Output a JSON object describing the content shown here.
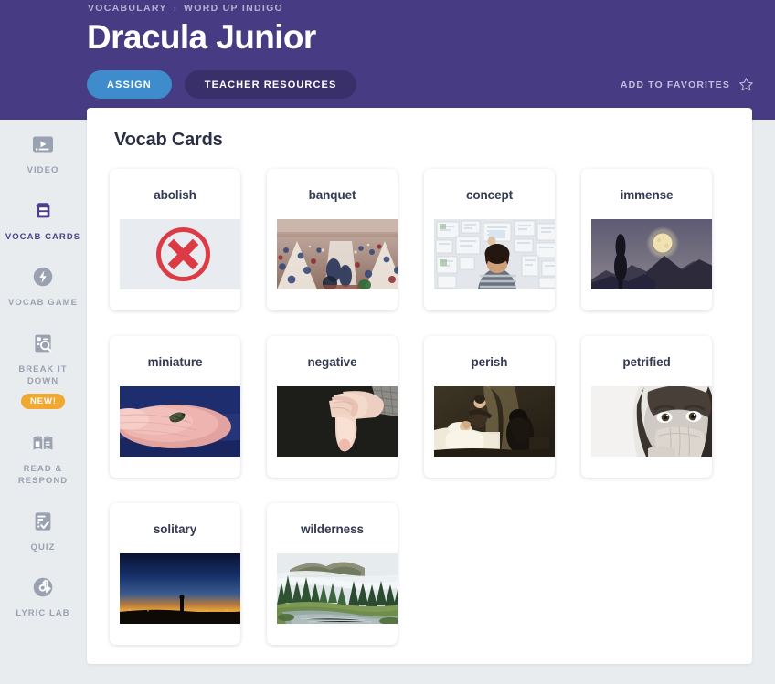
{
  "header": {
    "breadcrumb": [
      {
        "label": "VOCABULARY",
        "name": "breadcrumb-vocabulary"
      },
      {
        "label": "WORD UP INDIGO",
        "name": "breadcrumb-word-up-indigo"
      }
    ],
    "breadcrumb_separator": "›",
    "title": "Dracula Junior",
    "assign_label": "ASSIGN",
    "resources_label": "TEACHER RESOURCES",
    "favorites_label": "ADD TO FAVORITES",
    "favorites_icon": "star-outline-icon",
    "colors": {
      "header_bg": "#473c83",
      "assign_bg": "#3e8ccc",
      "resources_bg": "#3a3069",
      "breadcrumb_text": "#b7b0d4"
    }
  },
  "sidebar": {
    "items": [
      {
        "label": "VIDEO",
        "icon": "video-icon",
        "active": false,
        "badge": null
      },
      {
        "label": "VOCAB CARDS",
        "icon": "vocab-cards-icon",
        "active": true,
        "badge": null
      },
      {
        "label": "VOCAB GAME",
        "icon": "vocab-game-icon",
        "active": false,
        "badge": null
      },
      {
        "label": "BREAK IT DOWN",
        "icon": "break-it-down-icon",
        "active": false,
        "badge": "NEW!"
      },
      {
        "label": "READ & RESPOND",
        "icon": "read-and-respond-icon",
        "active": false,
        "badge": null
      },
      {
        "label": "QUIZ",
        "icon": "quiz-icon",
        "active": false,
        "badge": null
      },
      {
        "label": "LYRIC LAB",
        "icon": "lyric-lab-icon",
        "active": false,
        "badge": null
      }
    ],
    "colors": {
      "bg": "#e9ecef",
      "inactive_text": "#9aa1b1",
      "active_text": "#4b3f8c",
      "badge_bg": "#f0a831"
    }
  },
  "main": {
    "section_title": "Vocab Cards",
    "cards": [
      {
        "word": "abolish",
        "image": "red-x-circle-placeholder"
      },
      {
        "word": "banquet",
        "image": "medieval-banquet-hall-painting"
      },
      {
        "word": "concept",
        "image": "man-viewing-wall-of-sketches"
      },
      {
        "word": "immense",
        "image": "full-moon-over-mountains-at-dusk"
      },
      {
        "word": "miniature",
        "image": "tiny-beetle-on-fingertip"
      },
      {
        "word": "negative",
        "image": "thumbs-down-hand-on-black"
      },
      {
        "word": "perish",
        "image": "deathbed-scene-painting"
      },
      {
        "word": "petrified",
        "image": "frightened-girl-covering-mouth"
      },
      {
        "word": "solitary",
        "image": "lone-figure-silhouette-at-sunset"
      },
      {
        "word": "wilderness",
        "image": "misty-forest-river-landscape"
      }
    ]
  }
}
